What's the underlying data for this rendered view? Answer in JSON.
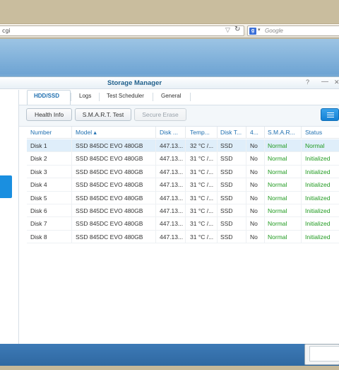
{
  "browser": {
    "url_fragment": "cgi",
    "search_placeholder": "Google",
    "search_engine_icon": "google-icon"
  },
  "window": {
    "title": "Storage Manager",
    "controls": {
      "help": "?",
      "minimize": "—",
      "close": "✕"
    }
  },
  "tabs": [
    {
      "label": "HDD/SSD",
      "active": true
    },
    {
      "label": "Logs"
    },
    {
      "label": "Test Scheduler"
    },
    {
      "label": "General"
    }
  ],
  "toolbar": {
    "health_info": "Health Info",
    "smart_test": "S.M.A.R.T. Test",
    "secure_erase": "Secure Erase",
    "menu_icon": "list-menu-icon"
  },
  "table": {
    "columns": [
      "Number",
      "Model ▴",
      "Disk ...",
      "Temp...",
      "Disk T...",
      "4...",
      "S.M.A.R...",
      "Status"
    ],
    "rows": [
      {
        "number": "Disk 1",
        "model": "SSD 845DC EVO 480GB",
        "size": "447.13...",
        "temp": "32 °C /...",
        "type": "SSD",
        "four": "No",
        "smart": "Normal",
        "status": "Normal"
      },
      {
        "number": "Disk 2",
        "model": "SSD 845DC EVO 480GB",
        "size": "447.13...",
        "temp": "31 °C /...",
        "type": "SSD",
        "four": "No",
        "smart": "Normal",
        "status": "Initialized"
      },
      {
        "number": "Disk 3",
        "model": "SSD 845DC EVO 480GB",
        "size": "447.13...",
        "temp": "31 °C /...",
        "type": "SSD",
        "four": "No",
        "smart": "Normal",
        "status": "Initialized"
      },
      {
        "number": "Disk 4",
        "model": "SSD 845DC EVO 480GB",
        "size": "447.13...",
        "temp": "31 °C /...",
        "type": "SSD",
        "four": "No",
        "smart": "Normal",
        "status": "Initialized"
      },
      {
        "number": "Disk 5",
        "model": "SSD 845DC EVO 480GB",
        "size": "447.13...",
        "temp": "31 °C /...",
        "type": "SSD",
        "four": "No",
        "smart": "Normal",
        "status": "Initialized"
      },
      {
        "number": "Disk 6",
        "model": "SSD 845DC EVO 480GB",
        "size": "447.13...",
        "temp": "31 °C /...",
        "type": "SSD",
        "four": "No",
        "smart": "Normal",
        "status": "Initialized"
      },
      {
        "number": "Disk 7",
        "model": "SSD 845DC EVO 480GB",
        "size": "447.13...",
        "temp": "31 °C /...",
        "type": "SSD",
        "four": "No",
        "smart": "Normal",
        "status": "Initialized"
      },
      {
        "number": "Disk 8",
        "model": "SSD 845DC EVO 480GB",
        "size": "447.13...",
        "temp": "31 °C /...",
        "type": "SSD",
        "four": "No",
        "smart": "Normal",
        "status": "Initialized"
      }
    ]
  },
  "colors": {
    "accent": "#1f6fb0",
    "status_green": "#1f9a1f",
    "selected_row": "#dfeefa"
  }
}
